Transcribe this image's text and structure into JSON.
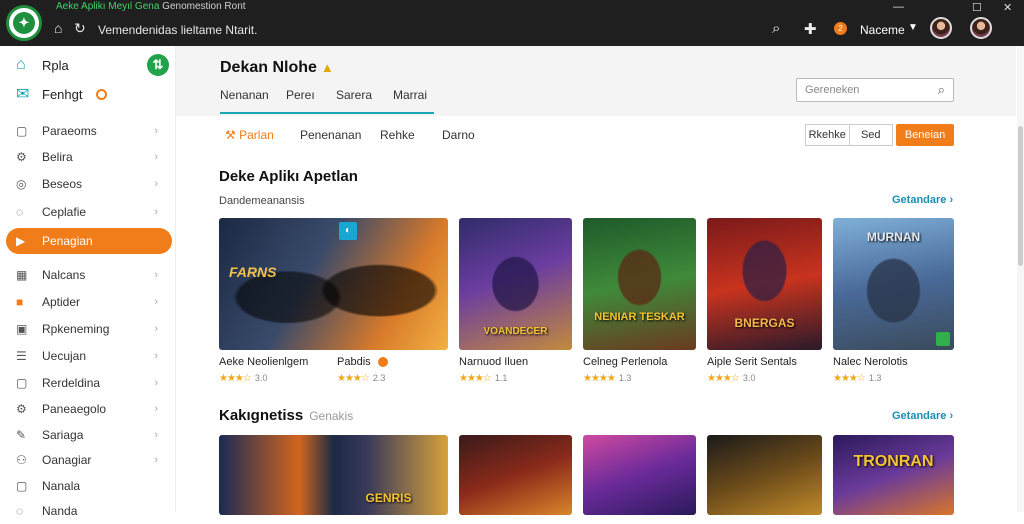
{
  "titlebar": {
    "app_title": "Aeke Aplikı Meyıl Gena",
    "app_subtitle": "Genomestion Ront",
    "address": "Vemendenidas lieltame Ntarit.",
    "user_name": "Naceme",
    "notif_count": "2",
    "icons": [
      "home-icon",
      "refresh-icon",
      "search-icon",
      "puzzle-icon",
      "minimize-icon",
      "maximize-icon",
      "close-icon"
    ]
  },
  "sidebar": {
    "top": [
      {
        "label": "Rpla",
        "icon": "home-icon"
      },
      {
        "label": "Fenhgt",
        "icon": "chat-icon"
      }
    ],
    "items": [
      {
        "label": "Paraeoms",
        "icon": "square-icon"
      },
      {
        "label": "Belira",
        "icon": "gear-icon"
      },
      {
        "label": "Beseos",
        "icon": "circle-icon"
      },
      {
        "label": "Ceplafie",
        "icon": "chat-icon"
      },
      {
        "label": "Penagian",
        "icon": "play-icon",
        "active": true
      },
      {
        "label": "Nalcans",
        "icon": "grid-icon"
      },
      {
        "label": "Aptider",
        "icon": "orange-square-icon"
      },
      {
        "label": "Rpkeneming",
        "icon": "box-icon"
      },
      {
        "label": "Uecujan",
        "icon": "list-icon"
      },
      {
        "label": "Rerdeldina",
        "icon": "square-icon"
      },
      {
        "label": "Paneaegolo",
        "icon": "gear-icon"
      },
      {
        "label": "Sariaga",
        "icon": "note-icon"
      },
      {
        "label": "Oanagiar",
        "icon": "people-icon"
      },
      {
        "label": "Nanala",
        "icon": "square-icon"
      },
      {
        "label": "Nanda",
        "icon": "chat-icon"
      }
    ]
  },
  "main": {
    "title": "Dekan Nlohe",
    "head_tabs": [
      "Nenanan",
      "Pereı",
      "Sarera",
      "Marrai"
    ],
    "search_placeholder": "Gereneken",
    "sub_tabs": [
      "Parlan",
      "Penenanan",
      "Rehke",
      "Darno"
    ],
    "filter_a": "Rkehke",
    "filter_b": "Sed",
    "primary_button": "Beneian",
    "section1": {
      "title": "Deke Aplikı Apetlan",
      "subtitle": "Dandemeanansis",
      "see_all": "Getandare ›"
    },
    "section2": {
      "title": "Kakıgnetiss",
      "muted": "Genakis",
      "see_all": "Getandare ›"
    },
    "games": [
      {
        "name": "Aeke Neolienlgem",
        "stars": "★★★☆",
        "rating": "3.0",
        "caption": "FARNS"
      },
      {
        "name": "Pabdis",
        "stars": "★★★☆",
        "rating": "2.3",
        "has_badge": true
      },
      {
        "name": "Narnuod Iluen",
        "stars": "★★★☆",
        "rating": "1.1",
        "caption": "VOANDECER"
      },
      {
        "name": "Celneg Perlenola",
        "stars": "★★★★",
        "rating": "1.3",
        "caption": "NENIAR TESKAR"
      },
      {
        "name": "Aiple Serit Sentals",
        "stars": "★★★☆",
        "rating": "3.0",
        "caption": "BNERGAS"
      },
      {
        "name": "Nalec Nerolotis",
        "stars": "★★★☆",
        "rating": "1.3",
        "caption": "MURNAN"
      }
    ],
    "games_row2": [
      {
        "caption": ""
      },
      {
        "caption": "GENRIS"
      },
      {
        "caption": ""
      },
      {
        "caption": ""
      },
      {
        "caption": ""
      },
      {
        "caption": "TRONRAN"
      }
    ]
  }
}
